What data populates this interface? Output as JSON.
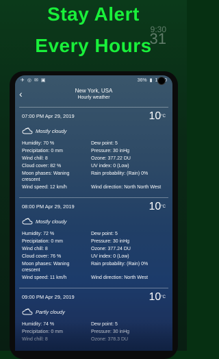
{
  "promo": {
    "line1": "Stay Alert",
    "line2": "Every Hours"
  },
  "behind": {
    "time": "9:30",
    "temp": "31"
  },
  "status": {
    "left1": "✈",
    "left2": "◎",
    "left3": "✉",
    "left4": "▣",
    "battery": "36%",
    "time": "12:40"
  },
  "appbar": {
    "back_icon": "chevron-left-icon",
    "title": "New York, USA",
    "subtitle": "Hourly weather"
  },
  "cards": [
    {
      "time": "07:00 PM Apr 29, 2019",
      "temp": "10",
      "unit": "°C",
      "condition": "Mostly cloudy",
      "left": [
        "Humidity: 70 %",
        "Precipitation: 0 mm",
        "Wind chill: 8",
        "Cloud cover: 82 %",
        "Moon phases: Waning crescent",
        "Wind speed: 12 km/h"
      ],
      "right": [
        "Dew point: 5",
        "Pressure: 30 inHg",
        "Ozone: 377.22 DU",
        "UV index: 0 (Low)",
        "Rain probability: (Rain) 0%",
        "Wind direction: North North West"
      ]
    },
    {
      "time": "08:00 PM Apr 29, 2019",
      "temp": "10",
      "unit": "°C",
      "condition": "Mostly cloudy",
      "left": [
        "Humidity: 72 %",
        "Precipitation: 0 mm",
        "Wind chill: 8",
        "Cloud cover: 76 %",
        "Moon phases: Waning crescent",
        "Wind speed: 11 km/h"
      ],
      "right": [
        "Dew point: 5",
        "Pressure: 30 inHg",
        "Ozone: 377.24 DU",
        "UV index: 0 (Low)",
        "Rain probability: (Rain) 0%",
        "Wind direction: North West"
      ]
    },
    {
      "time": "09:00 PM Apr 29, 2019",
      "temp": "10",
      "unit": "°C",
      "condition": "Partly cloudy",
      "left": [
        "Humidity: 74 %",
        "Precipitation: 0 mm",
        "Wind chill: 8"
      ],
      "right": [
        "Dew point: 5",
        "Pressure: 30 inHg",
        "Ozone: 378.3 DU"
      ]
    }
  ]
}
